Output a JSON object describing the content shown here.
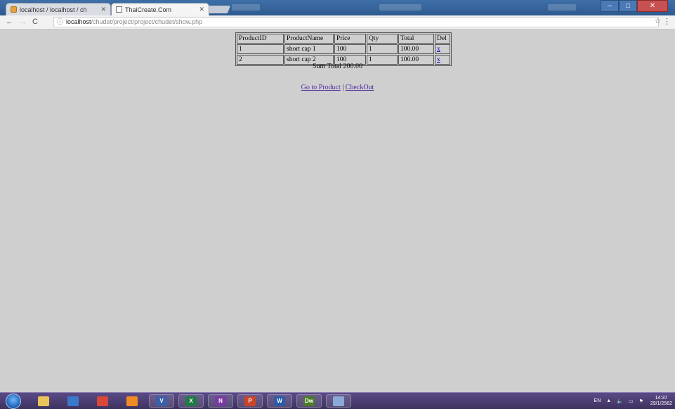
{
  "browser": {
    "tabs": [
      {
        "title": "localhost / localhost / ch",
        "icon": "phpmyadmin-icon",
        "active": false
      },
      {
        "title": "ThaiCreate.Com",
        "icon": "page-icon",
        "active": true
      }
    ],
    "address": {
      "host": "localhost",
      "path": "/chudet/project/project/chudet/show.php"
    }
  },
  "cart": {
    "headers": [
      "ProductID",
      "ProductName",
      "Price",
      "Qty",
      "Total",
      "Del"
    ],
    "rows": [
      {
        "id": "1",
        "name": "short cap 1",
        "price": "100",
        "qty": "1",
        "total": "100.00",
        "del": "x"
      },
      {
        "id": "2",
        "name": "short cap 2",
        "price": "100",
        "qty": "1",
        "total": "100.00",
        "del": "x"
      }
    ],
    "sum_total": "Sum Total 200.00",
    "links": {
      "product": "Go to Product",
      "separator": "|",
      "checkout": "CheckOut"
    }
  },
  "taskbar": {
    "apps": [
      {
        "name": "file-explorer-icon",
        "label": "",
        "color": "#e9c45a"
      },
      {
        "name": "media-player-icon",
        "label": "",
        "color": "#3a78c9"
      },
      {
        "name": "chrome-icon",
        "label": "",
        "color": "#d9473b"
      },
      {
        "name": "firefox-icon",
        "label": "",
        "color": "#f08a24"
      },
      {
        "name": "visio-icon",
        "label": "V",
        "color": "#3b5fa8"
      },
      {
        "name": "excel-icon",
        "label": "X",
        "color": "#1f7a43"
      },
      {
        "name": "onenote-icon",
        "label": "N",
        "color": "#7a3aa0"
      },
      {
        "name": "powerpoint-icon",
        "label": "P",
        "color": "#c9452a"
      },
      {
        "name": "word-icon",
        "label": "W",
        "color": "#2b5ba8"
      },
      {
        "name": "dreamweaver-icon",
        "label": "Dw",
        "color": "#4c7a2b"
      },
      {
        "name": "paint-icon",
        "label": "",
        "color": "#8aa9d6"
      }
    ],
    "lang": "EN",
    "time": "14:37",
    "date": "29/1/2562"
  }
}
